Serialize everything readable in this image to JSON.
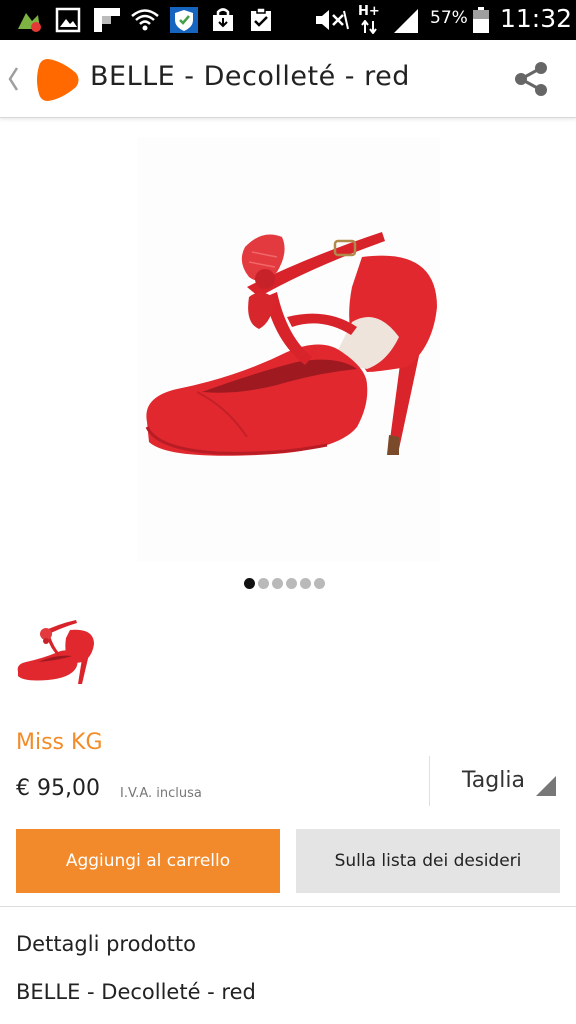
{
  "status_bar": {
    "battery_percent": "57%",
    "time": "11:32",
    "network_type": "H+",
    "icons": [
      "app-notification-icon",
      "gallery-icon",
      "flipboard-icon",
      "wifi-icon",
      "shield-icon",
      "shopping-bag-icon",
      "clipboard-check-icon",
      "mute-icon",
      "data-arrows-icon",
      "signal-icon",
      "battery-icon"
    ]
  },
  "app_bar": {
    "title": "BELLE - Decolleté - red",
    "back_icon": "chevron-left-icon",
    "logo": "zalando-logo",
    "share_icon": "share-icon",
    "accent_color": "#f28c28"
  },
  "gallery": {
    "page_count": 6,
    "active_index": 0,
    "product_color": "#e0282e"
  },
  "product": {
    "brand": "Miss KG",
    "price": "€ 95,00",
    "vat_note": "I.V.A. inclusa",
    "size_label": "Taglia"
  },
  "actions": {
    "add_to_cart": "Aggiungi al carrello",
    "wishlist": "Sulla lista dei desideri",
    "add_to_cart_color": "#f2892a",
    "wishlist_color": "#e4e4e4"
  },
  "details": {
    "heading": "Dettagli prodotto",
    "name": "BELLE - Decolleté - red"
  }
}
